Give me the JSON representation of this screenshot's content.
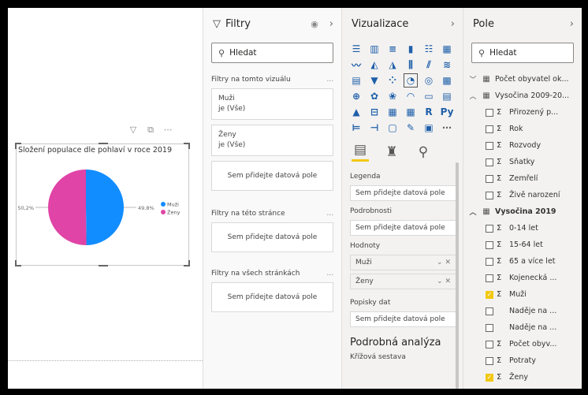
{
  "visual": {
    "title": "Složení populace dle pohlaví v roce 2019",
    "header_icons": [
      "filter-icon",
      "focus-icon",
      "more-options-icon"
    ],
    "more": "⋯"
  },
  "chart_data": {
    "type": "pie",
    "categories": [
      "Muži",
      "Ženy"
    ],
    "values": [
      49.8,
      50.2
    ],
    "data_labels": [
      "49,8%",
      "50,2%"
    ],
    "colors": [
      "#118dff",
      "#e044a7"
    ],
    "legend_placement": "right"
  },
  "filters": {
    "title": "Filtry",
    "search_placeholder": "Hledat",
    "on_visual_label": "Filtry na tomto vizuálu",
    "visual_filters": [
      {
        "field": "Muži",
        "state": "je (Vše)"
      },
      {
        "field": "Ženy",
        "state": "je (Vše)"
      }
    ],
    "drop_hint": "Sem přidejte datová pole",
    "on_page_label": "Filtry na této stránce",
    "on_all_pages_label": "Filtry na všech stránkách",
    "dots": "..."
  },
  "viz": {
    "title": "Vizualizace",
    "wells": [
      {
        "label": "Legenda",
        "value": "Sem přidejte datová pole"
      },
      {
        "label": "Podrobnosti",
        "value": "Sem přidejte datová pole"
      }
    ],
    "values_label": "Hodnoty",
    "values_fields": [
      "Muži",
      "Ženy"
    ],
    "tooltips_label": "Popisky dat",
    "tooltips_value": "Sem přidejte datová pole",
    "drill_title": "Podrobná analýza",
    "cross_report": "Křížová sestava"
  },
  "fields": {
    "title": "Pole",
    "search_placeholder": "Hledat",
    "tables": [
      {
        "name": "Počet obyvatel ok...",
        "expanded": false
      },
      {
        "name": "Vysočina 2009-20...",
        "expanded": true,
        "items": [
          "Přirozený p...",
          "Rok",
          "Rozvody",
          "Sňatky",
          "Zemřelí",
          "Živě narození"
        ]
      },
      {
        "name": "Vysočina 2019",
        "expanded": true,
        "items": [
          "0-14 let",
          "15-64 let",
          "65 a více let",
          "Kojenecká ...",
          "Muži",
          "Naděje na ...",
          "Naděje na ...",
          "Počet obyv...",
          "Potraty",
          "Ženy"
        ],
        "checked": [
          "Muži",
          "Ženy"
        ],
        "no_sigma": [
          5,
          6
        ]
      }
    ]
  }
}
